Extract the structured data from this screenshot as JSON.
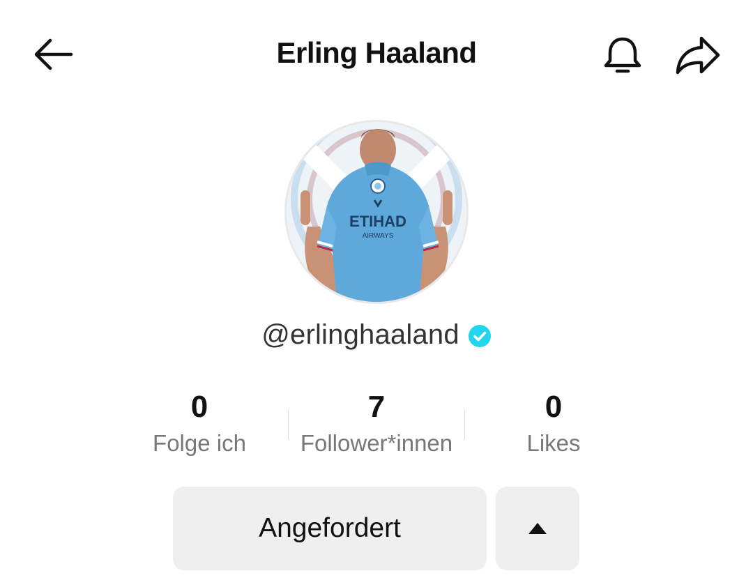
{
  "header": {
    "title": "Erling Haaland",
    "back_icon": "arrow-left-icon",
    "bell_icon": "bell-icon",
    "share_icon": "share-arrow-icon"
  },
  "profile": {
    "username": "@erlinghaaland",
    "verified": true,
    "verified_color": "#20d5ec",
    "avatar_icon": "profile-photo"
  },
  "stats": [
    {
      "value": "0",
      "label": "Folge ich"
    },
    {
      "value": "7",
      "label": "Follower*innen"
    },
    {
      "value": "0",
      "label": "Likes"
    }
  ],
  "actions": {
    "requested_label": "Angefordert",
    "more_icon": "triangle-up-icon"
  }
}
